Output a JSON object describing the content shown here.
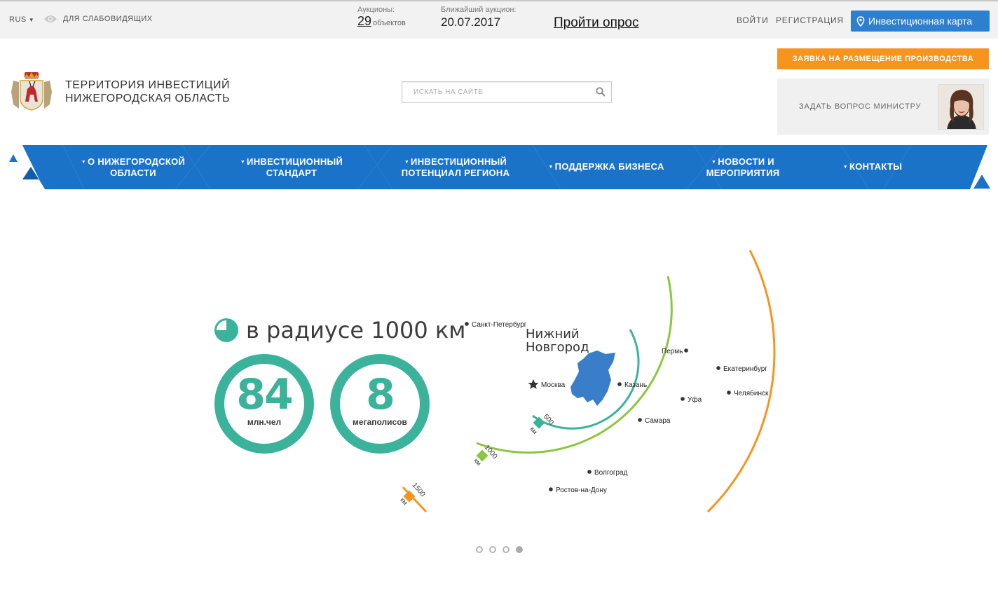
{
  "topbar": {
    "lang": "RUS",
    "accessibility": "ДЛЯ СЛАБОВИДЯЩИХ",
    "auctions_label": "Аукционы:",
    "auctions_count": "29",
    "auctions_unit": "объектов",
    "nearest_label": "Ближайший аукцион:",
    "nearest_date": "20.07.2017",
    "survey": "Пройти опрос",
    "login": "ВОЙТИ",
    "register": "РЕГИСТРАЦИЯ",
    "invest_map": "Инвестиционная карта"
  },
  "header": {
    "title_line1": "ТЕРРИТОРИЯ ИНВЕСТИЦИЙ",
    "title_line2": "НИЖЕГОРОДСКАЯ ОБЛАСТЬ",
    "search_placeholder": "ИСКАТЬ НА САЙТЕ",
    "apply_button": "ЗАЯВКА НА РАЗМЕЩЕНИЕ ПРОИЗВОДСТВА",
    "ask_minister": "ЗАДАТЬ ВОПРОС МИНИСТРУ"
  },
  "nav": {
    "items": [
      {
        "line1": "О НИЖЕГОРОДСКОЙ",
        "line2": "ОБЛАСТИ"
      },
      {
        "line1": "ИНВЕСТИЦИОННЫЙ",
        "line2": "СТАНДАРТ"
      },
      {
        "line1": "ИНВЕСТИЦИОННЫЙ",
        "line2": "ПОТЕНЦИАЛ РЕГИОНА"
      },
      {
        "line1": "ПОДДЕРЖКА БИЗНЕСА",
        "line2": ""
      },
      {
        "line1": "НОВОСТИ И",
        "line2": "МЕРОПРИЯТИЯ"
      },
      {
        "line1": "КОНТАКТЫ",
        "line2": ""
      }
    ]
  },
  "slide": {
    "headline": "в радиусе 1000 км",
    "stat1_value": "84",
    "stat1_label": "млн.чел",
    "stat2_value": "8",
    "stat2_label": "мегаполисов",
    "center_line1": "Нижний",
    "center_line2": "Новгород",
    "cities": [
      "Санкт-Петербург",
      "Москва",
      "Казань",
      "Пермь",
      "Екатеринбург",
      "Челябинск",
      "Уфа",
      "Самара",
      "Волгоград",
      "Ростов-на-Дону"
    ],
    "radii": [
      {
        "value": "500",
        "unit": "км",
        "color": "#3bb39a"
      },
      {
        "value": "1000",
        "unit": "км",
        "color": "#8cc63f"
      },
      {
        "value": "1500",
        "unit": "км",
        "color": "#f7941d"
      }
    ],
    "region_color": "#3a7dc9",
    "slides_total": 4,
    "slide_active": 4
  },
  "colors": {
    "accent_blue": "#1a73c9",
    "accent_orange": "#f7941d",
    "accent_green": "#3bb39a"
  }
}
